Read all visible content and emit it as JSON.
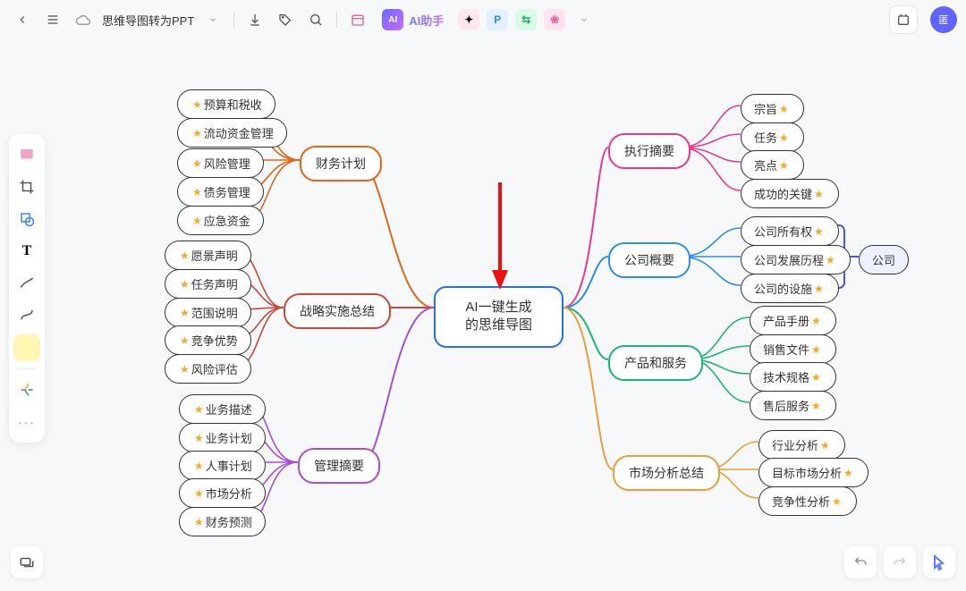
{
  "header": {
    "doc_title": "思维导图转为PPT",
    "ai_label": "AI助手"
  },
  "left_tools": {
    "t0": "图库",
    "t1": "裁剪",
    "t2": "矩形",
    "t3": "文字",
    "t4": "画笔",
    "t5": "曲线",
    "t6": "便签",
    "t7": "思维导图",
    "t8": "更多"
  },
  "tag_label": "公司",
  "mind": {
    "center1": "AI一键生成",
    "center2": "的思维导图",
    "left": {
      "fin": {
        "title": "财务计划",
        "items": [
          "预算和税收",
          "流动资金管理",
          "风险管理",
          "债务管理",
          "应急资金"
        ]
      },
      "strat": {
        "title": "战略实施总结",
        "items": [
          "愿景声明",
          "任务声明",
          "范围说明",
          "竞争优势",
          "风险评估"
        ]
      },
      "mgmt": {
        "title": "管理摘要",
        "items": [
          "业务描述",
          "业务计划",
          "人事计划",
          "市场分析",
          "财务预测"
        ]
      }
    },
    "right": {
      "exec": {
        "title": "执行摘要",
        "items": [
          "宗旨",
          "任务",
          "亮点",
          "成功的关键"
        ]
      },
      "comp": {
        "title": "公司概要",
        "items": [
          "公司所有权",
          "公司发展历程",
          "公司的设施"
        ]
      },
      "prod": {
        "title": "产品和服务",
        "items": [
          "产品手册",
          "销售文件",
          "技术规格",
          "售后服务"
        ]
      },
      "mkt": {
        "title": "市场分析总结",
        "items": [
          "行业分析",
          "目标市场分析",
          "竞争性分析"
        ]
      }
    }
  },
  "colors": {
    "fin": "#e0661a",
    "strat": "#c44b3c",
    "mgmt": "#a84fd6",
    "exec": "#e73b8f",
    "comp": "#2f8fe8",
    "prod": "#1fb574",
    "mkt": "#e8a13a"
  }
}
